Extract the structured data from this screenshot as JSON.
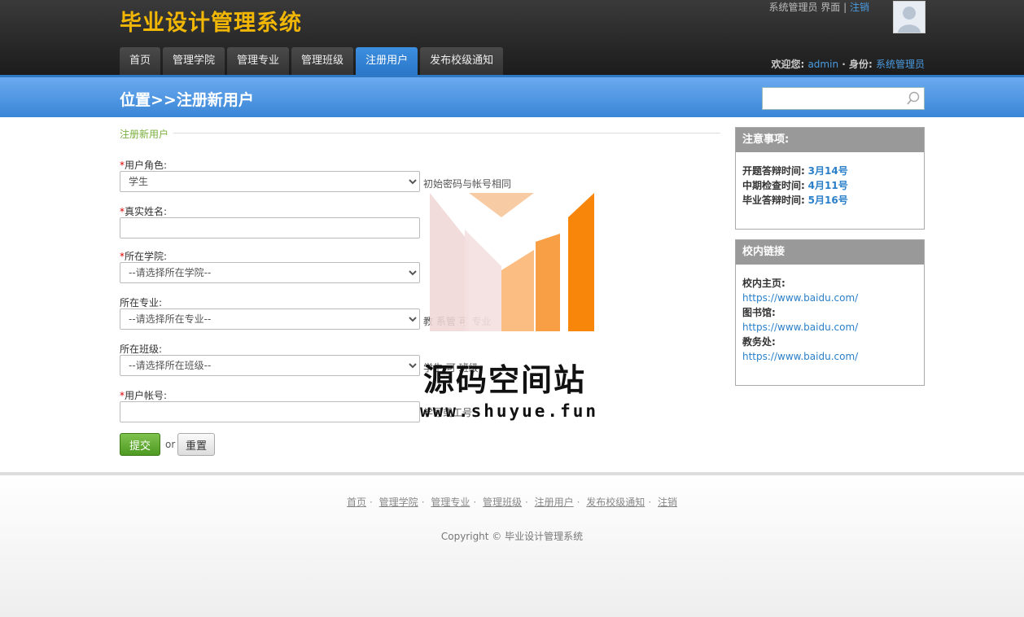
{
  "header": {
    "logo": "毕业设计管理系统",
    "role_label": "系统管理员 界面",
    "logout": "注销",
    "nav": [
      "首页",
      "管理学院",
      "管理专业",
      "管理班级",
      "注册用户",
      "发布校级通知"
    ],
    "welcome_label": "欢迎您:",
    "username": "admin",
    "identity_label": "· 身份:",
    "identity": "系统管理员"
  },
  "location": {
    "title": "位置>>注册新用户",
    "search_placeholder": ""
  },
  "form": {
    "legend": "注册新用户",
    "role_label": "用户角色:",
    "role_value": "学生",
    "role_hint": "初始密码与帐号相同",
    "name_label": "真实姓名:",
    "college_label": "所在学院:",
    "college_value": "--请选择所在学院--",
    "major_label": "所在专业:",
    "major_value": "--请选择所在专业--",
    "major_hint": "教 系管 可 专业",
    "class_label": "所在班级:",
    "class_value": "--请选择所在班级--",
    "class_hint": "学生 可 班级",
    "account_label": "用户帐号:",
    "account_hint": "学号或工号",
    "submit": "提交",
    "or": "or",
    "reset": "重置"
  },
  "notice": {
    "title": "注意事项:",
    "items": [
      {
        "label": "开题答辩时间:",
        "value": "3月14号"
      },
      {
        "label": "中期检查时间:",
        "value": "4月11号"
      },
      {
        "label": "毕业答辩时间:",
        "value": "5月16号"
      }
    ]
  },
  "links": {
    "title": "校内链接",
    "items": [
      {
        "label": "校内主页:",
        "url": "https://www.baidu.com/"
      },
      {
        "label": "图书馆:",
        "url": "https://www.baidu.com/"
      },
      {
        "label": "教务处:",
        "url": "https://www.baidu.com/"
      }
    ]
  },
  "watermark": {
    "text": "源码空间站",
    "url": "www.shuyue.fun"
  },
  "footer": {
    "links": [
      "首页",
      "管理学院",
      "管理专业",
      "管理班级",
      "注册用户",
      "发布校级通知",
      "注销"
    ],
    "copyright": "Copyright © 毕业设计管理系统"
  },
  "colors": {
    "accent": "#3a86d6",
    "logo": "#f2b705",
    "submit": "#4e9a22"
  }
}
